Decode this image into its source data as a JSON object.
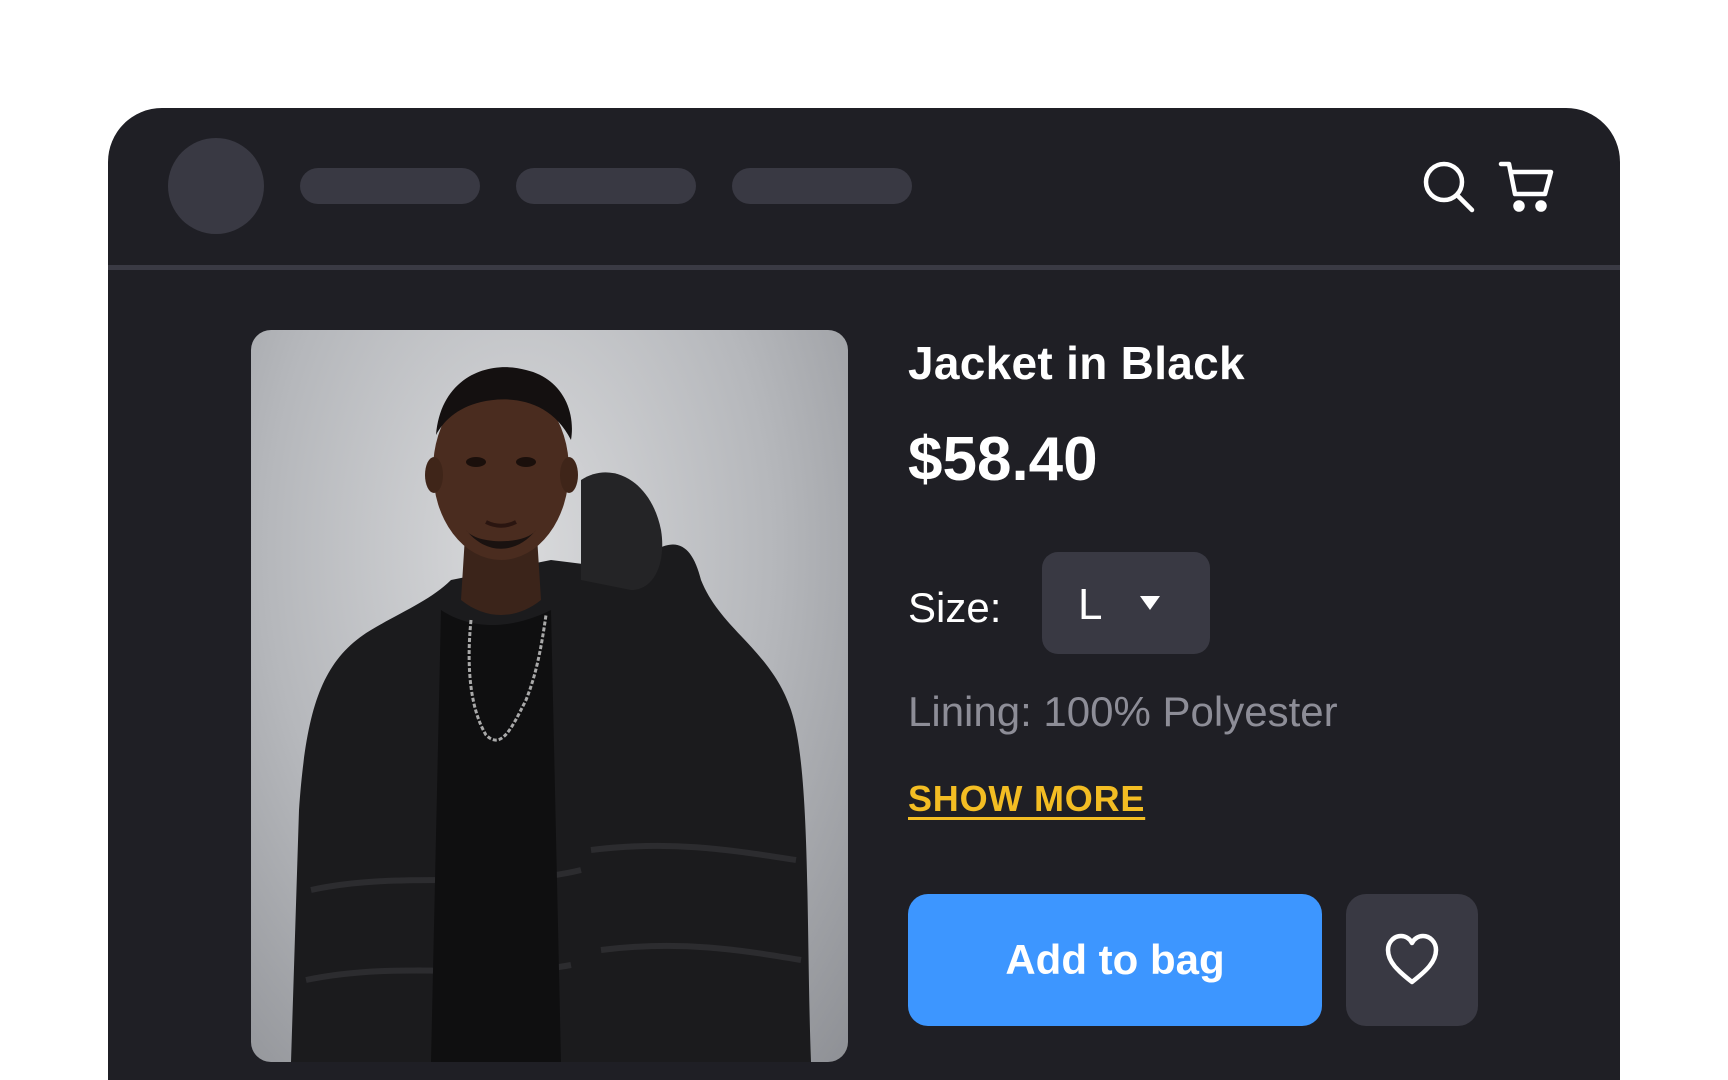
{
  "navbar": {
    "avatar": "avatar-placeholder",
    "nav_placeholders": 3,
    "search_icon": "search-icon",
    "cart_icon": "cart-icon"
  },
  "product": {
    "title": "Jacket in Black",
    "price": "$58.40",
    "image_icon": "product-photo",
    "size_label": "Size:",
    "size_selected": "L",
    "lining": "Lining: 100% Polyester",
    "show_more": "SHOW MORE",
    "add_to_bag": "Add to bag",
    "wishlist_icon": "heart-icon"
  },
  "colors": {
    "background": "#ffffff",
    "window": "#1f1f25",
    "placeholder": "#393943",
    "accent_link": "#f3bd23",
    "primary_button": "#3d96ff",
    "muted_text": "#8d8d97"
  }
}
